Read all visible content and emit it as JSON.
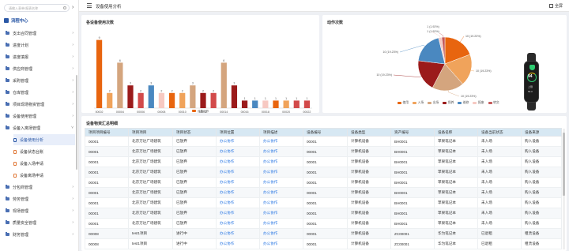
{
  "sidebar": {
    "search_placeholder": "请输入表单/报表名称",
    "root_label": "流程中心",
    "items": [
      {
        "label": "支出合同管理"
      },
      {
        "label": "进度计划"
      },
      {
        "label": "进度填报"
      },
      {
        "label": "供应商管理"
      },
      {
        "label": "采购管理"
      },
      {
        "label": "仓库管理"
      },
      {
        "label": "项目现场物资管理"
      },
      {
        "label": "设备使用管理"
      },
      {
        "label": "设备入离场管理"
      }
    ],
    "subitems": [
      {
        "label": "设备使用分析"
      },
      {
        "label": "设备状态台账"
      },
      {
        "label": "设备入场申请"
      },
      {
        "label": "设备离场申请"
      }
    ],
    "items_after": [
      {
        "label": "分包商管理"
      },
      {
        "label": "劳务管理"
      },
      {
        "label": "现场管理"
      },
      {
        "label": "质量安全管理"
      },
      {
        "label": "财务管理"
      }
    ]
  },
  "header": {
    "title": "设备使用分析",
    "fullscreen_label": "全屏"
  },
  "bar_card": {
    "title": "各设备使用次数"
  },
  "pie_card": {
    "title": "动作次数"
  },
  "table_card": {
    "title": "设备物资汇总明细"
  },
  "chart_data": [
    {
      "type": "bar",
      "title": "各设备使用次数",
      "categories": [
        "00002",
        "00003",
        "00004",
        "00005",
        "00006",
        "00007",
        "00008",
        "00009",
        "00010",
        "00011",
        "00012",
        "00013",
        "00014",
        "00015",
        "00016",
        "00017",
        "00018",
        "00019",
        "00020",
        "00021",
        "00022"
      ],
      "x_tick_labels": [
        "00002",
        "00004",
        "00006",
        "00008",
        "00010",
        "00012",
        "00014",
        "00016",
        "00018",
        "00020",
        "00022"
      ],
      "series": [
        {
          "name": "设备动作",
          "values": [
            9,
            2,
            6,
            3,
            2,
            3,
            2,
            2,
            2,
            3,
            2,
            2,
            6,
            3,
            1,
            1,
            1,
            1,
            1,
            1,
            1
          ]
        }
      ],
      "colors": [
        "#e8650f",
        "#f0a35b",
        "#d4a57e",
        "#9b1b1b",
        "#d24a4a",
        "#4a88c0",
        "#f7c9c2",
        "#e8650f",
        "#f0a35b",
        "#d4a57e",
        "#9b1b1b",
        "#d24a4a",
        "#d4a57e",
        "#9b1b1b",
        "#9b1b1b",
        "#4a88c0",
        "#f7c9c2",
        "#e8650f",
        "#f0a35b",
        "#d24a4a",
        "#d24a4a"
      ],
      "ylim": [
        0,
        10
      ],
      "legend": "bottom"
    },
    {
      "type": "pie",
      "title": "动作次数",
      "slices": [
        {
          "name": "使用",
          "value": 10,
          "label": "10 (19.23%)",
          "color": "#e8650f"
        },
        {
          "name": "入场",
          "value": 10,
          "label": "10 (19.23%)",
          "color": "#f0a35b"
        },
        {
          "name": "出场",
          "value": 10,
          "label": "10 (19.23%)",
          "color": "#d4a57e"
        },
        {
          "name": "保养",
          "value": 10,
          "label": "10 (19.23%)",
          "color": "#9b1b1b"
        },
        {
          "name": "维修",
          "value": 10,
          "label": "10 (19.23%)",
          "color": "#4a88c0"
        },
        {
          "name": "报废",
          "value": 1,
          "label": "1 (1.92%)",
          "color": "#f7c9c2"
        },
        {
          "name": "转交",
          "value": 1,
          "label": "1 (1.92%)",
          "color": "#c45a5a"
        }
      ],
      "legend": "bottom"
    }
  ],
  "watch": {
    "value": "94",
    "line1": "上限",
    "line2": "56.0"
  },
  "table": {
    "columns": [
      "项目项目编号",
      "项目项目",
      "项目状态",
      "项目位置",
      "项目描述",
      "设备编号",
      "设备类型",
      "资产编号",
      "设备名称",
      "设备当前状态",
      "设备来源"
    ],
    "rows": [
      [
        "00001",
        "北京万达广场建筑",
        "已放弃",
        "办公协作",
        "办公协作",
        "00001",
        "计算机设备",
        "BH0001",
        "苹果笔记本",
        "未入场",
        "购入设备"
      ],
      [
        "00001",
        "北京万达广场建筑",
        "已放弃",
        "办公协作",
        "办公协作",
        "00001",
        "计算机设备",
        "BH0001",
        "苹果笔记本",
        "未入场",
        "购入设备"
      ],
      [
        "00001",
        "北京万达广场建筑",
        "已放弃",
        "办公协作",
        "办公协作",
        "00001",
        "计算机设备",
        "BH0001",
        "苹果笔记本",
        "未入场",
        "购入设备"
      ],
      [
        "00001",
        "北京万达广场建筑",
        "已放弃",
        "办公协作",
        "办公协作",
        "00001",
        "计算机设备",
        "BH0001",
        "苹果笔记本",
        "未入场",
        "购入设备"
      ],
      [
        "00001",
        "北京万达广场建筑",
        "已放弃",
        "办公协作",
        "办公协作",
        "00001",
        "计算机设备",
        "BH0001",
        "苹果笔记本",
        "未入场",
        "购入设备"
      ],
      [
        "00001",
        "北京万达广场建筑",
        "已放弃",
        "办公协作",
        "办公协作",
        "00001",
        "计算机设备",
        "BH0001",
        "苹果笔记本",
        "未入场",
        "购入设备"
      ],
      [
        "00001",
        "北京万达广场建筑",
        "已放弃",
        "办公协作",
        "办公协作",
        "00001",
        "计算机设备",
        "BH0001",
        "苹果笔记本",
        "未入场",
        "购入设备"
      ],
      [
        "00001",
        "北京万达广场建筑",
        "已放弃",
        "办公协作",
        "办公协作",
        "00001",
        "计算机设备",
        "BH0001",
        "苹果笔记本",
        "未入场",
        "购入设备"
      ],
      [
        "00001",
        "北京万达广场建筑",
        "已放弃",
        "办公协作",
        "办公协作",
        "00001",
        "计算机设备",
        "BH0001",
        "苹果笔记本",
        "未入场",
        "购入设备"
      ],
      [
        "00008",
        "test1项目",
        "进行中",
        "办公协作",
        "办公协作",
        "00001",
        "计算机设备",
        "ZC00001",
        "华为笔记本",
        "已退租",
        "租赁设备"
      ],
      [
        "00008",
        "test1项目",
        "进行中",
        "办公协作",
        "办公协作",
        "00001",
        "计算机设备",
        "ZC00001",
        "华为笔记本",
        "已退租",
        "租赁设备"
      ]
    ]
  }
}
